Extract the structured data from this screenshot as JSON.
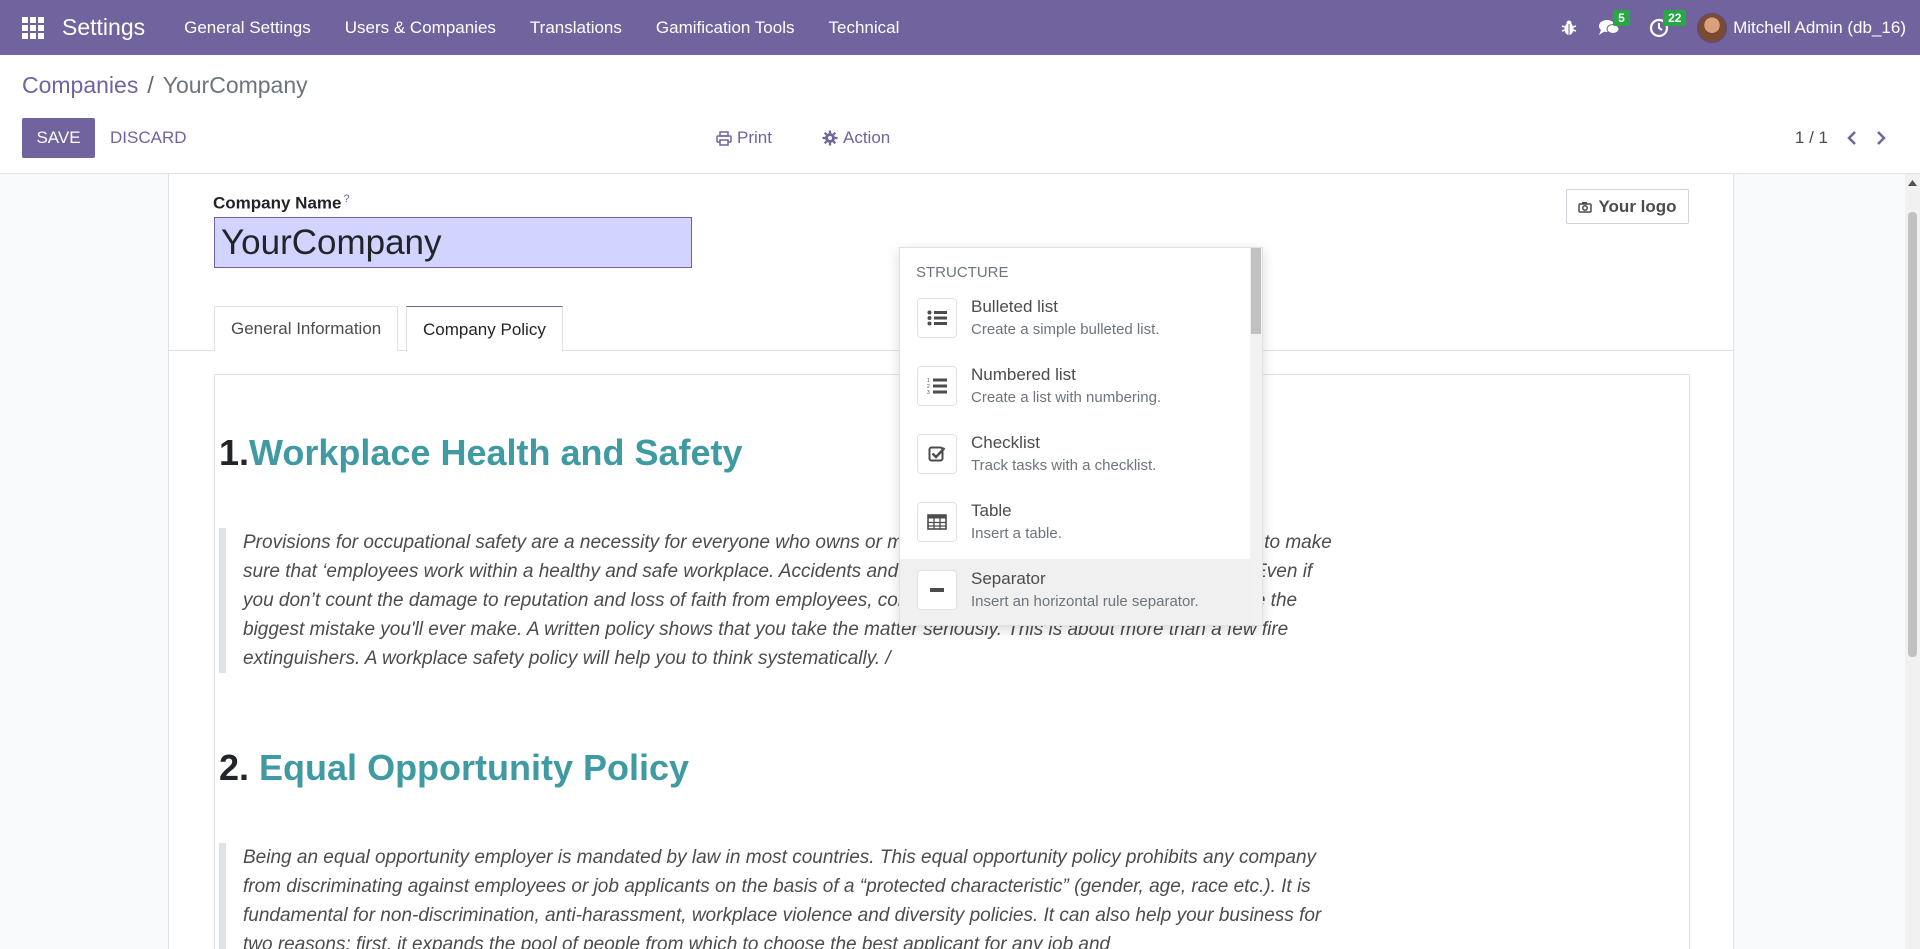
{
  "navbar": {
    "app_name": "Settings",
    "menu": [
      "General Settings",
      "Users & Companies",
      "Translations",
      "Gamification Tools",
      "Technical"
    ],
    "messages_badge": "5",
    "activities_badge": "22",
    "user_name": "Mitchell Admin (db_16)",
    "background": "#71639e"
  },
  "breadcrumb": {
    "parent": "Companies",
    "separator": "/",
    "current": "YourCompany"
  },
  "toolbar": {
    "save_label": "SAVE",
    "discard_label": "DISCARD",
    "print_label": "Print",
    "action_label": "Action",
    "pager": "1 / 1"
  },
  "form": {
    "company_name_label": "Company Name",
    "help_mark": "?",
    "company_name_value": "YourCompany",
    "logo_label": "Your logo"
  },
  "tabs": [
    {
      "label": "General Information",
      "active": false
    },
    {
      "label": "Company Policy",
      "active": true
    }
  ],
  "editor": {
    "sections": [
      {
        "number": "1.",
        "title": "Workplace Health and Safety",
        "text": "Provisions for occupational safety are a necessity for everyone who owns or manages a business. It is your responsibility to make sure that ‘employees work within a healthy and safe workplace. Accidents and unsafe conditions are not good business. Even if you don’t count the damage to reputation and loss of faith from employees, complacency about workplace safety could be the biggest mistake you'll ever make. A written policy shows that you take the matter seriously. This is about more than a few fire extinguishers. A workplace safety policy will help you to think systematically. /"
      },
      {
        "number": "2.",
        "title": "Equal Opportunity Policy",
        "text": "Being an equal opportunity employer is mandated by law in most countries. This equal opportunity policy prohibits any company from discriminating against employees or job applicants on the basis of a “protected characteristic” (gender, age, race etc.). It is fundamental for non-discrimination, anti-harassment, workplace violence and diversity policies. It can also help your business for two reasons: first, it expands the pool of people from which to choose the best applicant for any job and"
      }
    ],
    "accent_color": "#3f9aa2"
  },
  "powerbox": {
    "category": "STRUCTURE",
    "items": [
      {
        "title": "Bulleted list",
        "description": "Create a simple bulleted list.",
        "icon": "bulleted-list-icon"
      },
      {
        "title": "Numbered list",
        "description": "Create a list with numbering.",
        "icon": "numbered-list-icon"
      },
      {
        "title": "Checklist",
        "description": "Track tasks with a checklist.",
        "icon": "checklist-icon"
      },
      {
        "title": "Table",
        "description": "Insert a table.",
        "icon": "table-icon"
      },
      {
        "title": "Separator",
        "description": "Insert an horizontal rule separator.",
        "icon": "separator-icon",
        "active": true
      }
    ]
  }
}
